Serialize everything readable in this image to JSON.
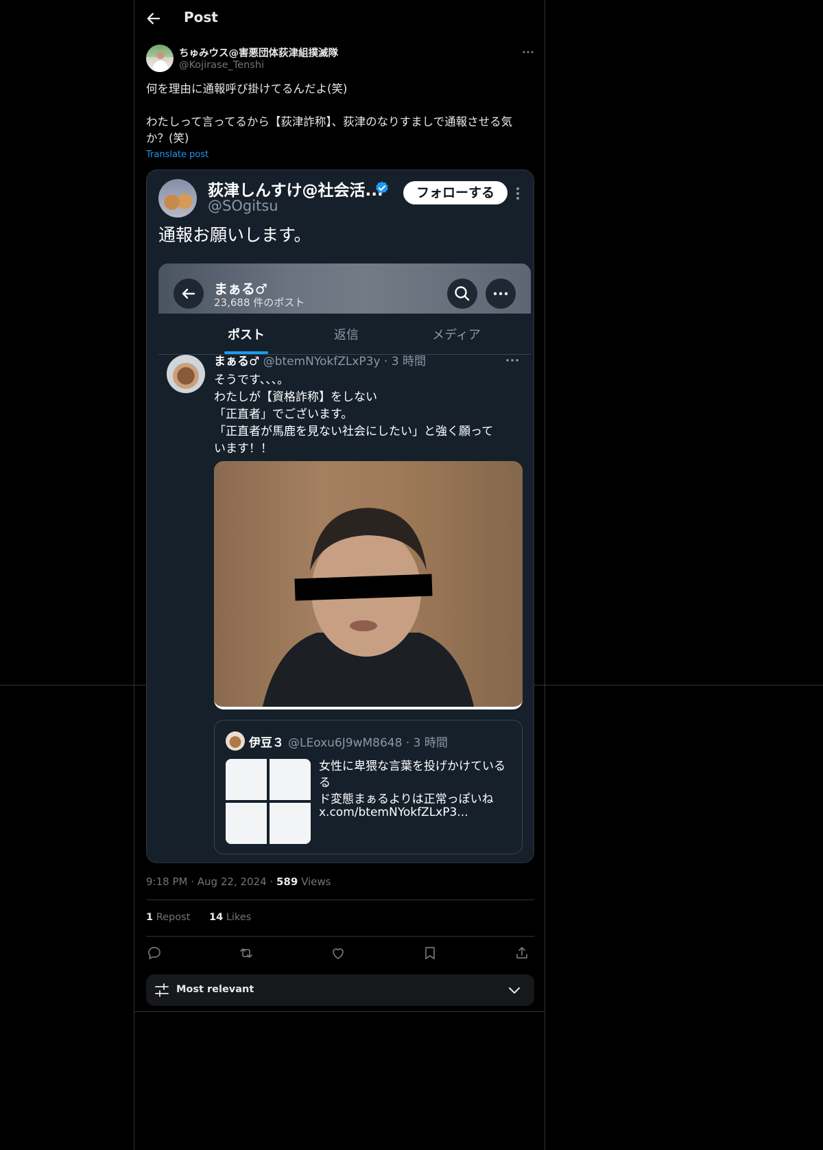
{
  "header": {
    "title": "Post"
  },
  "author": {
    "name": "ちゅみウス@害悪団体荻津組撲滅隊",
    "handle": "@Kojirase_Tenshi"
  },
  "post": {
    "text": "何を理由に通報呼び掛けてるんだよ(笑)\n\nわたしって言ってるから【荻津詐称】、荻津のなりすましで通報させる気か？(笑)",
    "translate_label": "Translate post",
    "time": "9:18 PM",
    "date": "Aug 22, 2024",
    "views_count": "589",
    "views_label": "Views",
    "reposts_count": "1",
    "reposts_label": "Repost",
    "likes_count": "14",
    "likes_label": "Likes"
  },
  "embedded": {
    "name": "荻津しんすけ@社会活...",
    "handle": "@SOgitsu",
    "follow_label": "フォローする",
    "text": "通報お願いします。",
    "profile": {
      "name": "まぁる♂",
      "post_count": "23,688 件のポスト",
      "tabs": [
        "ポスト",
        "返信",
        "メディア"
      ]
    },
    "tweet": {
      "name": "まぁる♂",
      "handle_time": "@btemNYokfZLxP3y · 3 時間",
      "lines": [
        "そうです、、、。",
        "わたしが【資格詐称】をしない",
        "「正直者」でございます。",
        "「正直者が馬鹿を見ない社会にしたい」と強く願って",
        "います！！"
      ]
    },
    "quote": {
      "name": "伊豆３",
      "handle_time": "@LEoxu6J9wM8648 · 3 時間",
      "lines": [
        "女性に卑猥な言葉を投げかけている",
        "る",
        "ド変態まぁるよりは正常っぽいね",
        "x.com/btemNYokfZLxP3..."
      ]
    }
  },
  "sort": {
    "label": "Most relevant"
  },
  "icons": [
    "back-arrow-icon",
    "more-icon",
    "verified-icon",
    "search-icon",
    "reply-icon",
    "repost-icon",
    "like-icon",
    "bookmark-icon",
    "share-icon",
    "filter-icon",
    "chevron-down-icon"
  ],
  "colors": {
    "background": "#000000",
    "accent": "#1d9bf0",
    "text": "#e7e9ea",
    "muted": "#71767b",
    "dim_bg": "#15202b"
  }
}
